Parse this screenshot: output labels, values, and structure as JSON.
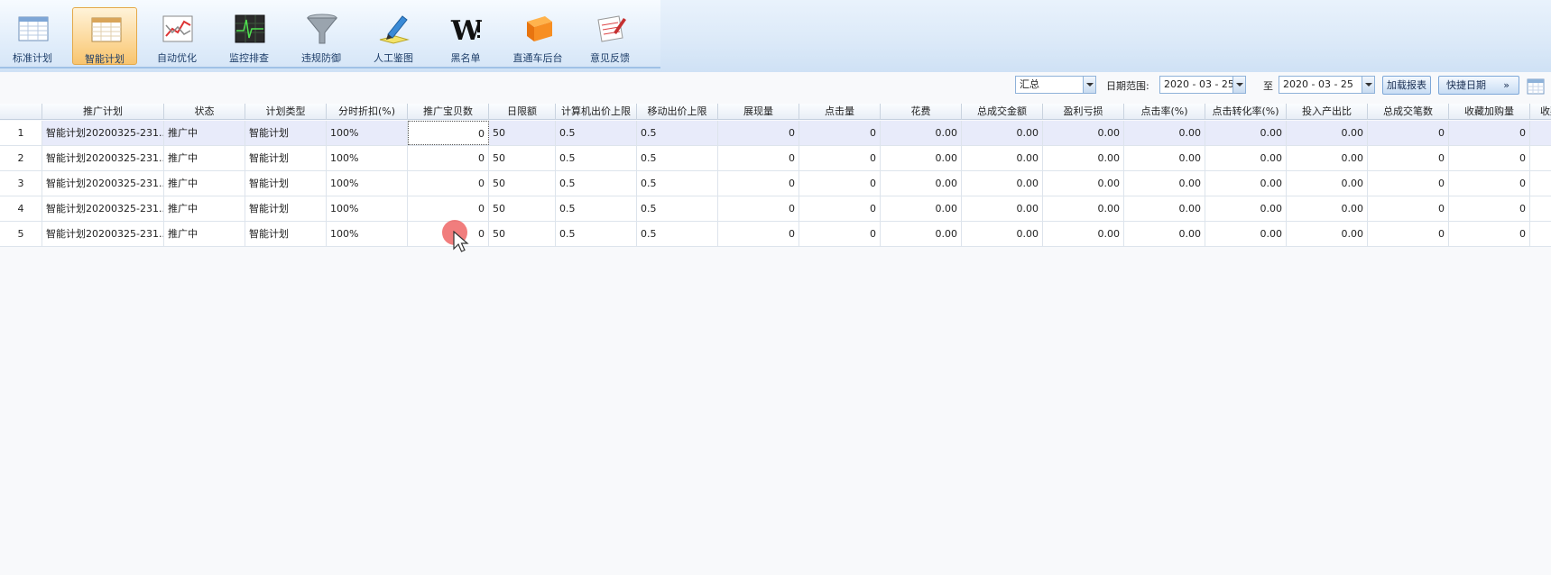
{
  "toolbar": {
    "items": [
      {
        "label": "标准计划",
        "icon": "spreadsheet-icon",
        "active": false
      },
      {
        "label": "智能计划",
        "icon": "spreadsheet-icon",
        "active": true
      },
      {
        "label": "自动优化",
        "icon": "trend-chart-icon",
        "active": false
      },
      {
        "label": "监控排查",
        "icon": "monitor-icon",
        "active": false
      },
      {
        "label": "违规防御",
        "icon": "funnel-icon",
        "active": false
      },
      {
        "label": "人工鉴图",
        "icon": "pen-edit-icon",
        "active": false
      },
      {
        "label": "黑名单",
        "icon": "w-logo-icon",
        "active": false
      },
      {
        "label": "直通车后台",
        "icon": "orange-block-icon",
        "active": false
      },
      {
        "label": "意见反馈",
        "icon": "feedback-notepad-icon",
        "active": false
      }
    ]
  },
  "filters": {
    "summary_select": "汇总",
    "date_range_label": "日期范围:",
    "start_date": "2020 - 03 - 25",
    "to_label": "至",
    "end_date": "2020 - 03 - 25",
    "load_report_label": "加载报表",
    "quick_date_label": "快捷日期",
    "quick_date_chevron": "»"
  },
  "grid": {
    "columns": [
      "",
      "推广计划",
      "状态",
      "计划类型",
      "分时折扣(%)",
      "推广宝贝数",
      "日限额",
      "计算机出价上限",
      "移动出价上限",
      "展现量",
      "点击量",
      "花费",
      "总成交金额",
      "盈利亏损",
      "点击率(%)",
      "点击转化率(%)",
      "投入产出比",
      "总成交笔数",
      "收藏加购量",
      "收藏加"
    ],
    "rows": [
      [
        "1",
        "智能计划20200325-231...",
        "推广中",
        "智能计划",
        "100%",
        "0",
        "50",
        "0.5",
        "0.5",
        "0",
        "0",
        "0.00",
        "0.00",
        "0.00",
        "0.00",
        "0.00",
        "0.00",
        "0",
        "0",
        ""
      ],
      [
        "2",
        "智能计划20200325-231...",
        "推广中",
        "智能计划",
        "100%",
        "0",
        "50",
        "0.5",
        "0.5",
        "0",
        "0",
        "0.00",
        "0.00",
        "0.00",
        "0.00",
        "0.00",
        "0.00",
        "0",
        "0",
        ""
      ],
      [
        "3",
        "智能计划20200325-231...",
        "推广中",
        "智能计划",
        "100%",
        "0",
        "50",
        "0.5",
        "0.5",
        "0",
        "0",
        "0.00",
        "0.00",
        "0.00",
        "0.00",
        "0.00",
        "0.00",
        "0",
        "0",
        ""
      ],
      [
        "4",
        "智能计划20200325-231...",
        "推广中",
        "智能计划",
        "100%",
        "0",
        "50",
        "0.5",
        "0.5",
        "0",
        "0",
        "0.00",
        "0.00",
        "0.00",
        "0.00",
        "0.00",
        "0.00",
        "0",
        "0",
        ""
      ],
      [
        "5",
        "智能计划20200325-231...",
        "推广中",
        "智能计划",
        "100%",
        "0",
        "50",
        "0.5",
        "0.5",
        "0",
        "0",
        "0.00",
        "0.00",
        "0.00",
        "0.00",
        "0.00",
        "0.00",
        "0",
        "0",
        ""
      ]
    ],
    "selected_row": 0
  },
  "colors": {
    "active_tab": "#f8c46e",
    "selected_row": "#e8ebfa",
    "click_indicator": "#ee5c5c"
  }
}
